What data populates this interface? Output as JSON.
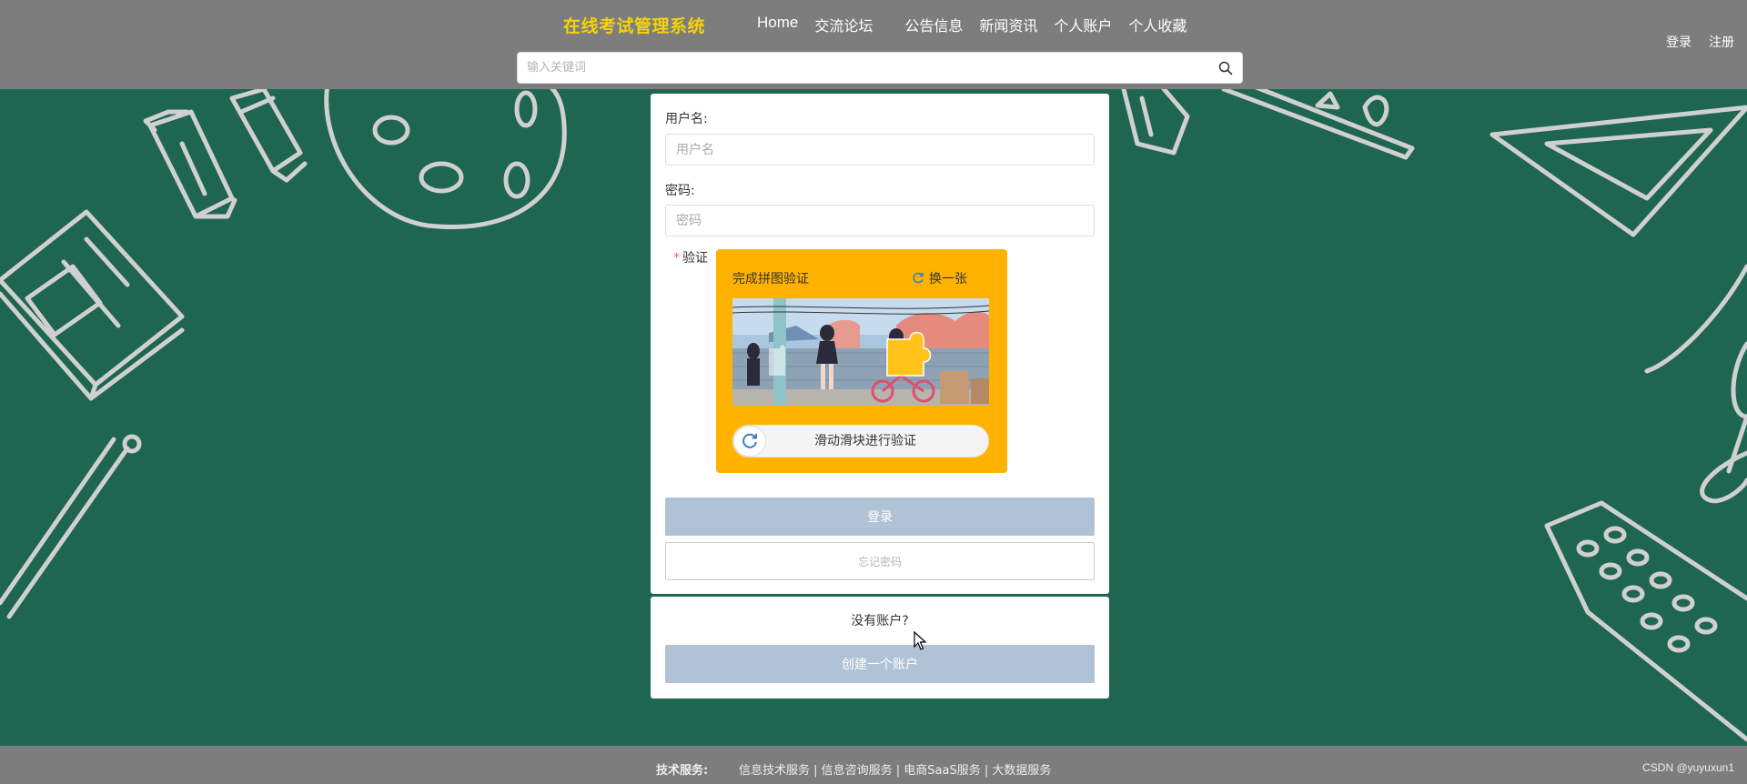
{
  "header": {
    "logo": "在线考试管理系统",
    "nav": [
      "Home",
      "交流论坛",
      "公告信息",
      "新闻资讯",
      "个人账户",
      "个人收藏"
    ],
    "auth": {
      "login": "登录",
      "register": "注册"
    },
    "search": {
      "placeholder": "输入关键词",
      "icon": "search-icon"
    }
  },
  "login_form": {
    "username_label": "用户名:",
    "username_placeholder": "用户名",
    "password_label": "密码:",
    "password_placeholder": "密码",
    "verify_label": "验证",
    "required_mark": "*",
    "captcha": {
      "title": "完成拼图验证",
      "refresh_label": "换一张",
      "slider_text": "滑动滑块进行验证",
      "color": "#ffb300"
    },
    "login_button": "登录",
    "forgot_button": "忘记密码"
  },
  "register_box": {
    "prompt": "没有账户?",
    "create_button": "创建一个账户"
  },
  "footer": {
    "label": "技术服务:",
    "links": "信息技术服务 | 信息咨询服务 | 电商SaaS服务 | 大数据服务",
    "credit": "CSDN @yuyuxun1"
  },
  "colors": {
    "background": "#1e6650",
    "header": "#7d7d7d",
    "logo": "#f5d20a",
    "button": "#b0c2d6"
  }
}
